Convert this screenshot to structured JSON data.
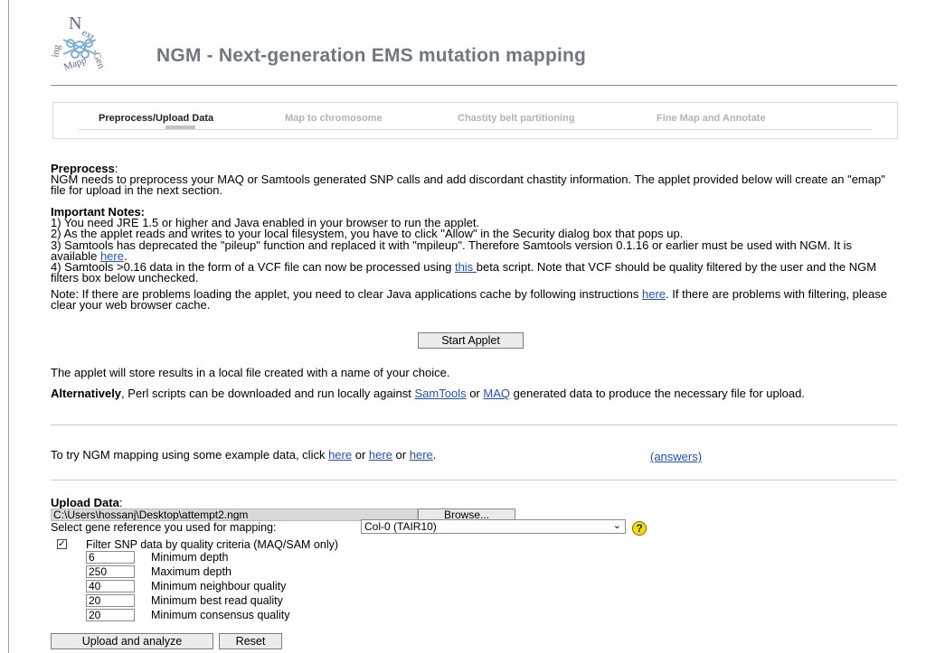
{
  "header": {
    "title": "NGM - Next-generation EMS mutation mapping",
    "logo_text": "Next-Gen Mapping"
  },
  "tabs": [
    {
      "label": "Preprocess/Upload Data",
      "active": true
    },
    {
      "label": "Map to chromosome",
      "active": false
    },
    {
      "label": "Chastity belt partitioning",
      "active": false
    },
    {
      "label": "Fine Map and Annotate",
      "active": false
    }
  ],
  "preprocess": {
    "heading": "Preprocess",
    "heading_suffix": ":",
    "text": "NGM needs to preprocess your MAQ or Samtools generated SNP calls and add discordant chastity information. The applet provided below will create an \"emap\" file for upload in the next section."
  },
  "notes": {
    "heading": "Important Notes:",
    "n1": "1) You need JRE 1.5 or higher and Java enabled in your browser to run the applet.",
    "n2": "2) As the applet reads and writes to your local filesystem, you have to click \"Allow\" in the Security dialog box that pops up.",
    "n3_a": "3) Samtools has deprecated the \"pileup\" function and replaced it with \"mpileup\". Therefore Samtools version 0.1.16 or earlier must be used with NGM. It is available ",
    "n3_link": "here",
    "n3_b": ".",
    "n4_a": "4) Samtools >0.16 data in the form of a VCF file can now be processed using ",
    "n4_link": "this ",
    "n4_b": "beta script. Note that VCF should be quality filtered by the user and the NGM filters box below unchecked."
  },
  "note2": {
    "a": "Note: If there are problems loading the applet, you need to clear Java applications cache by following instructions ",
    "link": "here",
    "b": ". If there are problems with filtering, please clear your web browser cache."
  },
  "start_applet": "Start Applet",
  "store_text": "The applet will store results in a local file created with a name of your choice.",
  "alt": {
    "bold": "Alternatively",
    "a": ", Perl scripts can be downloaded and run locally against ",
    "link1": "SamTools",
    "mid": " or ",
    "link2": "MAQ",
    "b": " generated data to produce the necessary file for upload."
  },
  "example": {
    "a": "To try NGM mapping using some example data, click ",
    "link1": "here",
    "or1": " or ",
    "link2": "here",
    "or2": " or ",
    "link3": "here",
    "end": ".",
    "answers": "(answers)"
  },
  "upload": {
    "heading": "Upload Data",
    "heading_suffix": ":",
    "file_value": "C:\\Users\\hossanj\\Desktop\\attempt2.ngm",
    "browse": "Browse...",
    "select_label": "Select gene reference you used for mapping:",
    "select_value": "Col-0 (TAIR10)",
    "help": "?",
    "filter_label": "Filter SNP data by quality criteria (MAQ/SAM only)",
    "filter_checked": true,
    "params": [
      {
        "value": "6",
        "label": "Minimum depth"
      },
      {
        "value": "250",
        "label": "Maximum depth"
      },
      {
        "value": "40",
        "label": "Minimum neighbour quality"
      },
      {
        "value": "20",
        "label": "Minimum best read quality"
      },
      {
        "value": "20",
        "label": "Minimum consensus quality"
      }
    ],
    "upload_button": "Upload and analyze",
    "reset_button": "Reset"
  }
}
